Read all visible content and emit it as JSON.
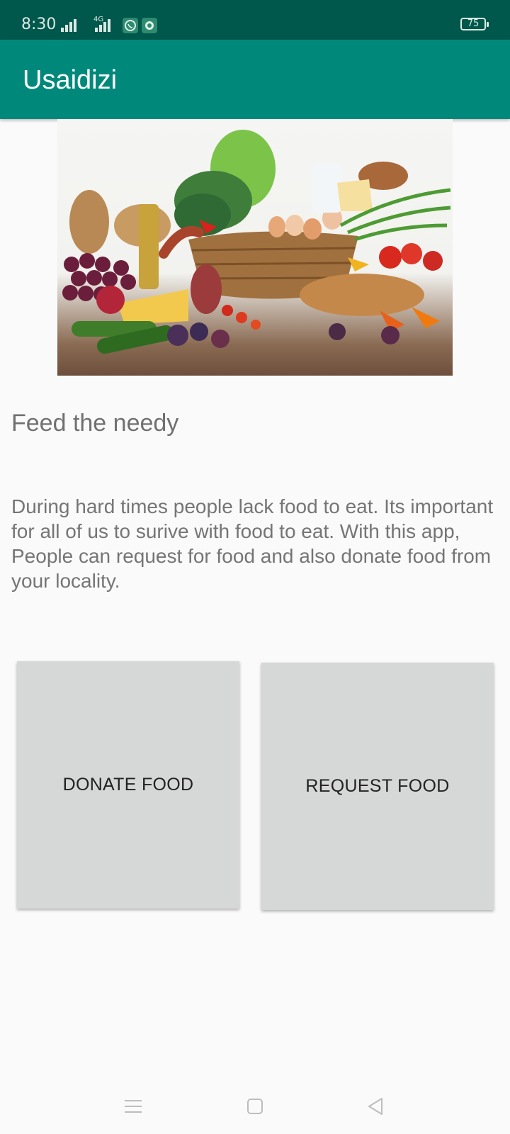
{
  "status_bar": {
    "time": "8:30",
    "network_label": "4G",
    "battery": "75"
  },
  "app_bar": {
    "title": "Usaidizi"
  },
  "hero": {
    "icon": "food-basket-image"
  },
  "content": {
    "headline": "Feed the needy",
    "description": "During hard times people lack food to eat. Its important for all of us to surive with food to eat. With this app, People can request for food and also donate food from your locality."
  },
  "actions": {
    "donate_label": "DONATE FOOD",
    "request_label": "REQUEST FOOD"
  },
  "colors": {
    "status_bar": "#00574b",
    "app_bar": "#00897b",
    "button_bg": "#d6d7d7"
  },
  "nav": {
    "icons": [
      "menu-icon",
      "home-square-icon",
      "back-triangle-icon"
    ]
  }
}
